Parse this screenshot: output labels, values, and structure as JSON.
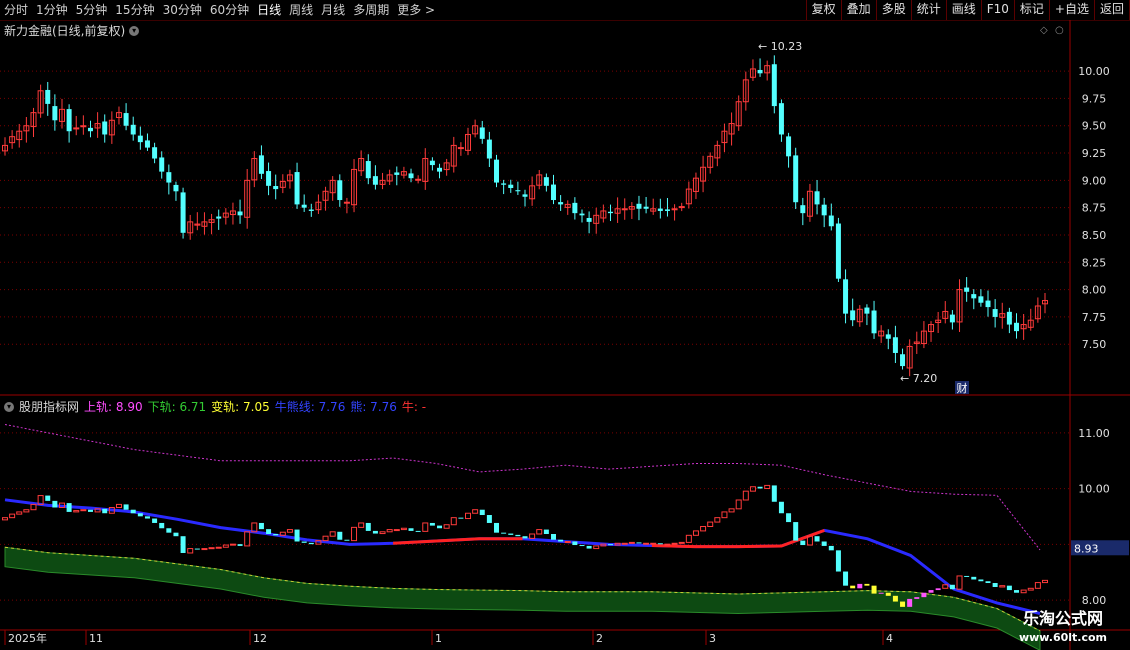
{
  "toolbar": {
    "periods": [
      "分时",
      "1分钟",
      "5分钟",
      "15分钟",
      "30分钟",
      "60分钟",
      "日线",
      "周线",
      "月线",
      "多周期",
      "更多 >"
    ],
    "active_period": "日线",
    "buttons": [
      "复权",
      "叠加",
      "多股",
      "统计",
      "画线",
      "F10",
      "标记",
      "+自选",
      "返回"
    ]
  },
  "main_title": "新力金融(日线,前复权)",
  "price_labels": {
    "high": "10.23",
    "low": "7.20",
    "badge": "财"
  },
  "price_axis": [
    "10.00",
    "9.75",
    "9.50",
    "9.25",
    "9.00",
    "8.75",
    "8.50",
    "8.25",
    "8.00",
    "7.75",
    "7.50"
  ],
  "indicator": {
    "name": "股朋指标网",
    "items": [
      {
        "label": "上轨:",
        "value": "8.90",
        "color": "#ff4dff"
      },
      {
        "label": "下轨:",
        "value": "6.71",
        "color": "#33cc33"
      },
      {
        "label": "变轨:",
        "value": "7.05",
        "color": "#ffff33"
      },
      {
        "label": "牛熊线:",
        "value": "7.76",
        "color": "#3344ff"
      },
      {
        "label": "熊:",
        "value": "7.76",
        "color": "#3344ff"
      },
      {
        "label": "牛:",
        "value": "-",
        "color": "#ff3333"
      }
    ],
    "axis": [
      "11.00",
      "10.00",
      "9.00",
      "8.00"
    ],
    "current_value": "8.93"
  },
  "time_axis": [
    "2025年",
    "11",
    "12",
    "1",
    "2",
    "3",
    "4"
  ],
  "logo": {
    "line1": "乐淘公式网",
    "line2": "www.60lt.com"
  },
  "colors": {
    "up": "#ff3b3b",
    "down": "#54ffff",
    "grid": "#7a0000",
    "frame": "#9a0000"
  },
  "chart_data": [
    {
      "type": "candlestick",
      "title": "新力金融(日线,前复权)",
      "ylim": [
        7.2,
        10.23
      ],
      "y_ticks": [
        7.5,
        7.75,
        8.0,
        8.25,
        8.5,
        8.75,
        9.0,
        9.25,
        9.5,
        9.75,
        10.0
      ],
      "x_ticks": [
        "2025年",
        "11",
        "12",
        "1",
        "2",
        "3",
        "4"
      ],
      "close": [
        9.32,
        9.4,
        9.45,
        9.5,
        9.62,
        9.82,
        9.7,
        9.55,
        9.65,
        9.45,
        9.48,
        9.5,
        9.45,
        9.52,
        9.42,
        9.55,
        9.62,
        9.5,
        9.42,
        9.35,
        9.3,
        9.2,
        9.08,
        8.98,
        8.9,
        8.52,
        8.62,
        8.6,
        8.62,
        8.64,
        8.65,
        8.7,
        8.72,
        8.68,
        9.0,
        9.2,
        9.06,
        8.95,
        8.92,
        8.99,
        9.05,
        8.78,
        8.75,
        8.72,
        8.8,
        8.9,
        9.0,
        8.82,
        8.8,
        9.1,
        9.2,
        9.02,
        8.96,
        9.0,
        9.05,
        9.05,
        9.08,
        9.02,
        9.01,
        9.2,
        9.14,
        9.08,
        9.16,
        9.32,
        9.3,
        9.42,
        9.5,
        9.38,
        9.2,
        8.98,
        8.96,
        8.93,
        8.9,
        8.85,
        8.95,
        9.05,
        8.95,
        8.82,
        8.78,
        8.78,
        8.7,
        8.68,
        8.62,
        8.68,
        8.72,
        8.7,
        8.74,
        8.74,
        8.76,
        8.74,
        8.74,
        8.74,
        8.72,
        8.72,
        8.74,
        8.76,
        8.92,
        9.02,
        9.12,
        9.22,
        9.32,
        9.45,
        9.52,
        9.72,
        9.92,
        10.02,
        9.98,
        10.05,
        9.68,
        9.42,
        9.22,
        8.8,
        8.7,
        8.9,
        8.78,
        8.68,
        8.58,
        8.1,
        7.78,
        7.72,
        7.82,
        7.78,
        7.6,
        7.62,
        7.55,
        7.42,
        7.3,
        7.48,
        7.52,
        7.62,
        7.68,
        7.72,
        7.8,
        7.7,
        8.0,
        7.98,
        7.92,
        7.88,
        7.84,
        7.75,
        7.78,
        7.68,
        7.62,
        7.68,
        7.72,
        7.85,
        7.9
      ]
    },
    {
      "type": "line",
      "title": "股朋指标网",
      "ylim": [
        7.5,
        11.5
      ],
      "y_ticks": [
        8.0,
        9.0,
        10.0,
        11.0
      ],
      "series": [
        {
          "name": "上轨",
          "values": [
            11.15,
            11.0,
            10.85,
            10.7,
            10.6,
            10.5,
            10.5,
            10.5,
            10.5,
            10.55,
            10.45,
            10.3,
            10.35,
            10.42,
            10.35,
            10.4,
            10.45,
            10.45,
            10.42,
            10.25,
            10.1,
            9.95,
            9.9,
            9.88,
            8.9
          ]
        },
        {
          "name": "下轨",
          "values": [
            8.6,
            8.5,
            8.45,
            8.4,
            8.3,
            8.2,
            8.05,
            7.95,
            7.9,
            7.86,
            7.84,
            7.83,
            7.82,
            7.8,
            7.8,
            7.8,
            7.78,
            7.76,
            7.78,
            7.8,
            7.82,
            7.8,
            7.7,
            7.5,
            7.1
          ]
        },
        {
          "name": "牛熊线",
          "values": [
            9.8,
            9.7,
            9.65,
            9.58,
            9.45,
            9.3,
            9.2,
            9.08,
            9.0,
            9.02,
            9.06,
            9.1,
            9.1,
            9.05,
            9.0,
            8.98,
            8.96,
            8.96,
            8.97,
            9.25,
            9.1,
            8.8,
            8.2,
            7.95,
            7.76
          ]
        }
      ]
    }
  ]
}
